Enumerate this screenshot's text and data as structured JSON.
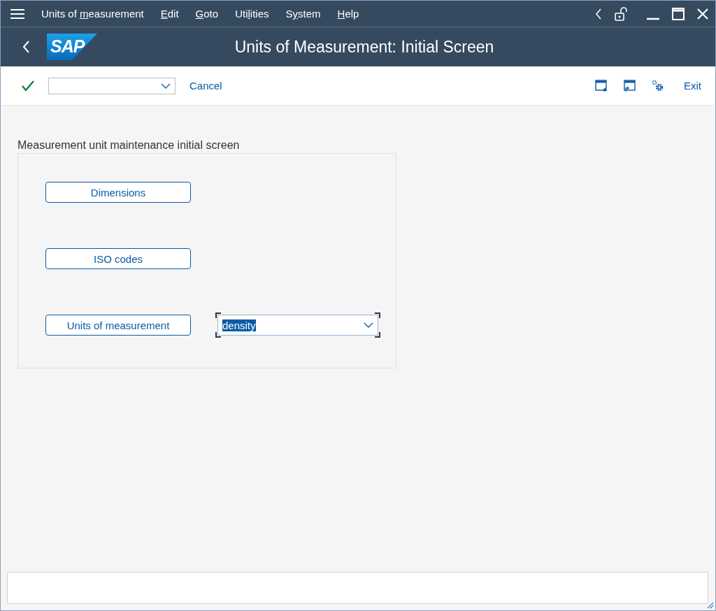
{
  "menu_bar": {
    "items": [
      {
        "before": "Units of ",
        "key": "m",
        "after": "easurement"
      },
      {
        "key": "E",
        "after": "dit"
      },
      {
        "key": "G",
        "after": "oto"
      },
      {
        "before": "Uti",
        "key": "l",
        "after": "ities"
      },
      {
        "before": "S",
        "key": "y",
        "after": "stem"
      },
      {
        "key": "H",
        "after": "elp"
      }
    ]
  },
  "header": {
    "logo": "SAP",
    "title": "Units of Measurement: Initial Screen"
  },
  "toolbar": {
    "left_buttons": [
      "Cancel"
    ],
    "right_buttons": [
      "Exit"
    ]
  },
  "group": {
    "title": "Measurement unit maintenance initial screen",
    "rows": [
      {
        "kind": "button",
        "label": "Dimensions"
      },
      {
        "kind": "button",
        "label": "ISO codes"
      },
      {
        "kind": "button_with_dropdown",
        "label": "Units of measurement",
        "dropdown_value": "density",
        "focused": true
      }
    ]
  }
}
